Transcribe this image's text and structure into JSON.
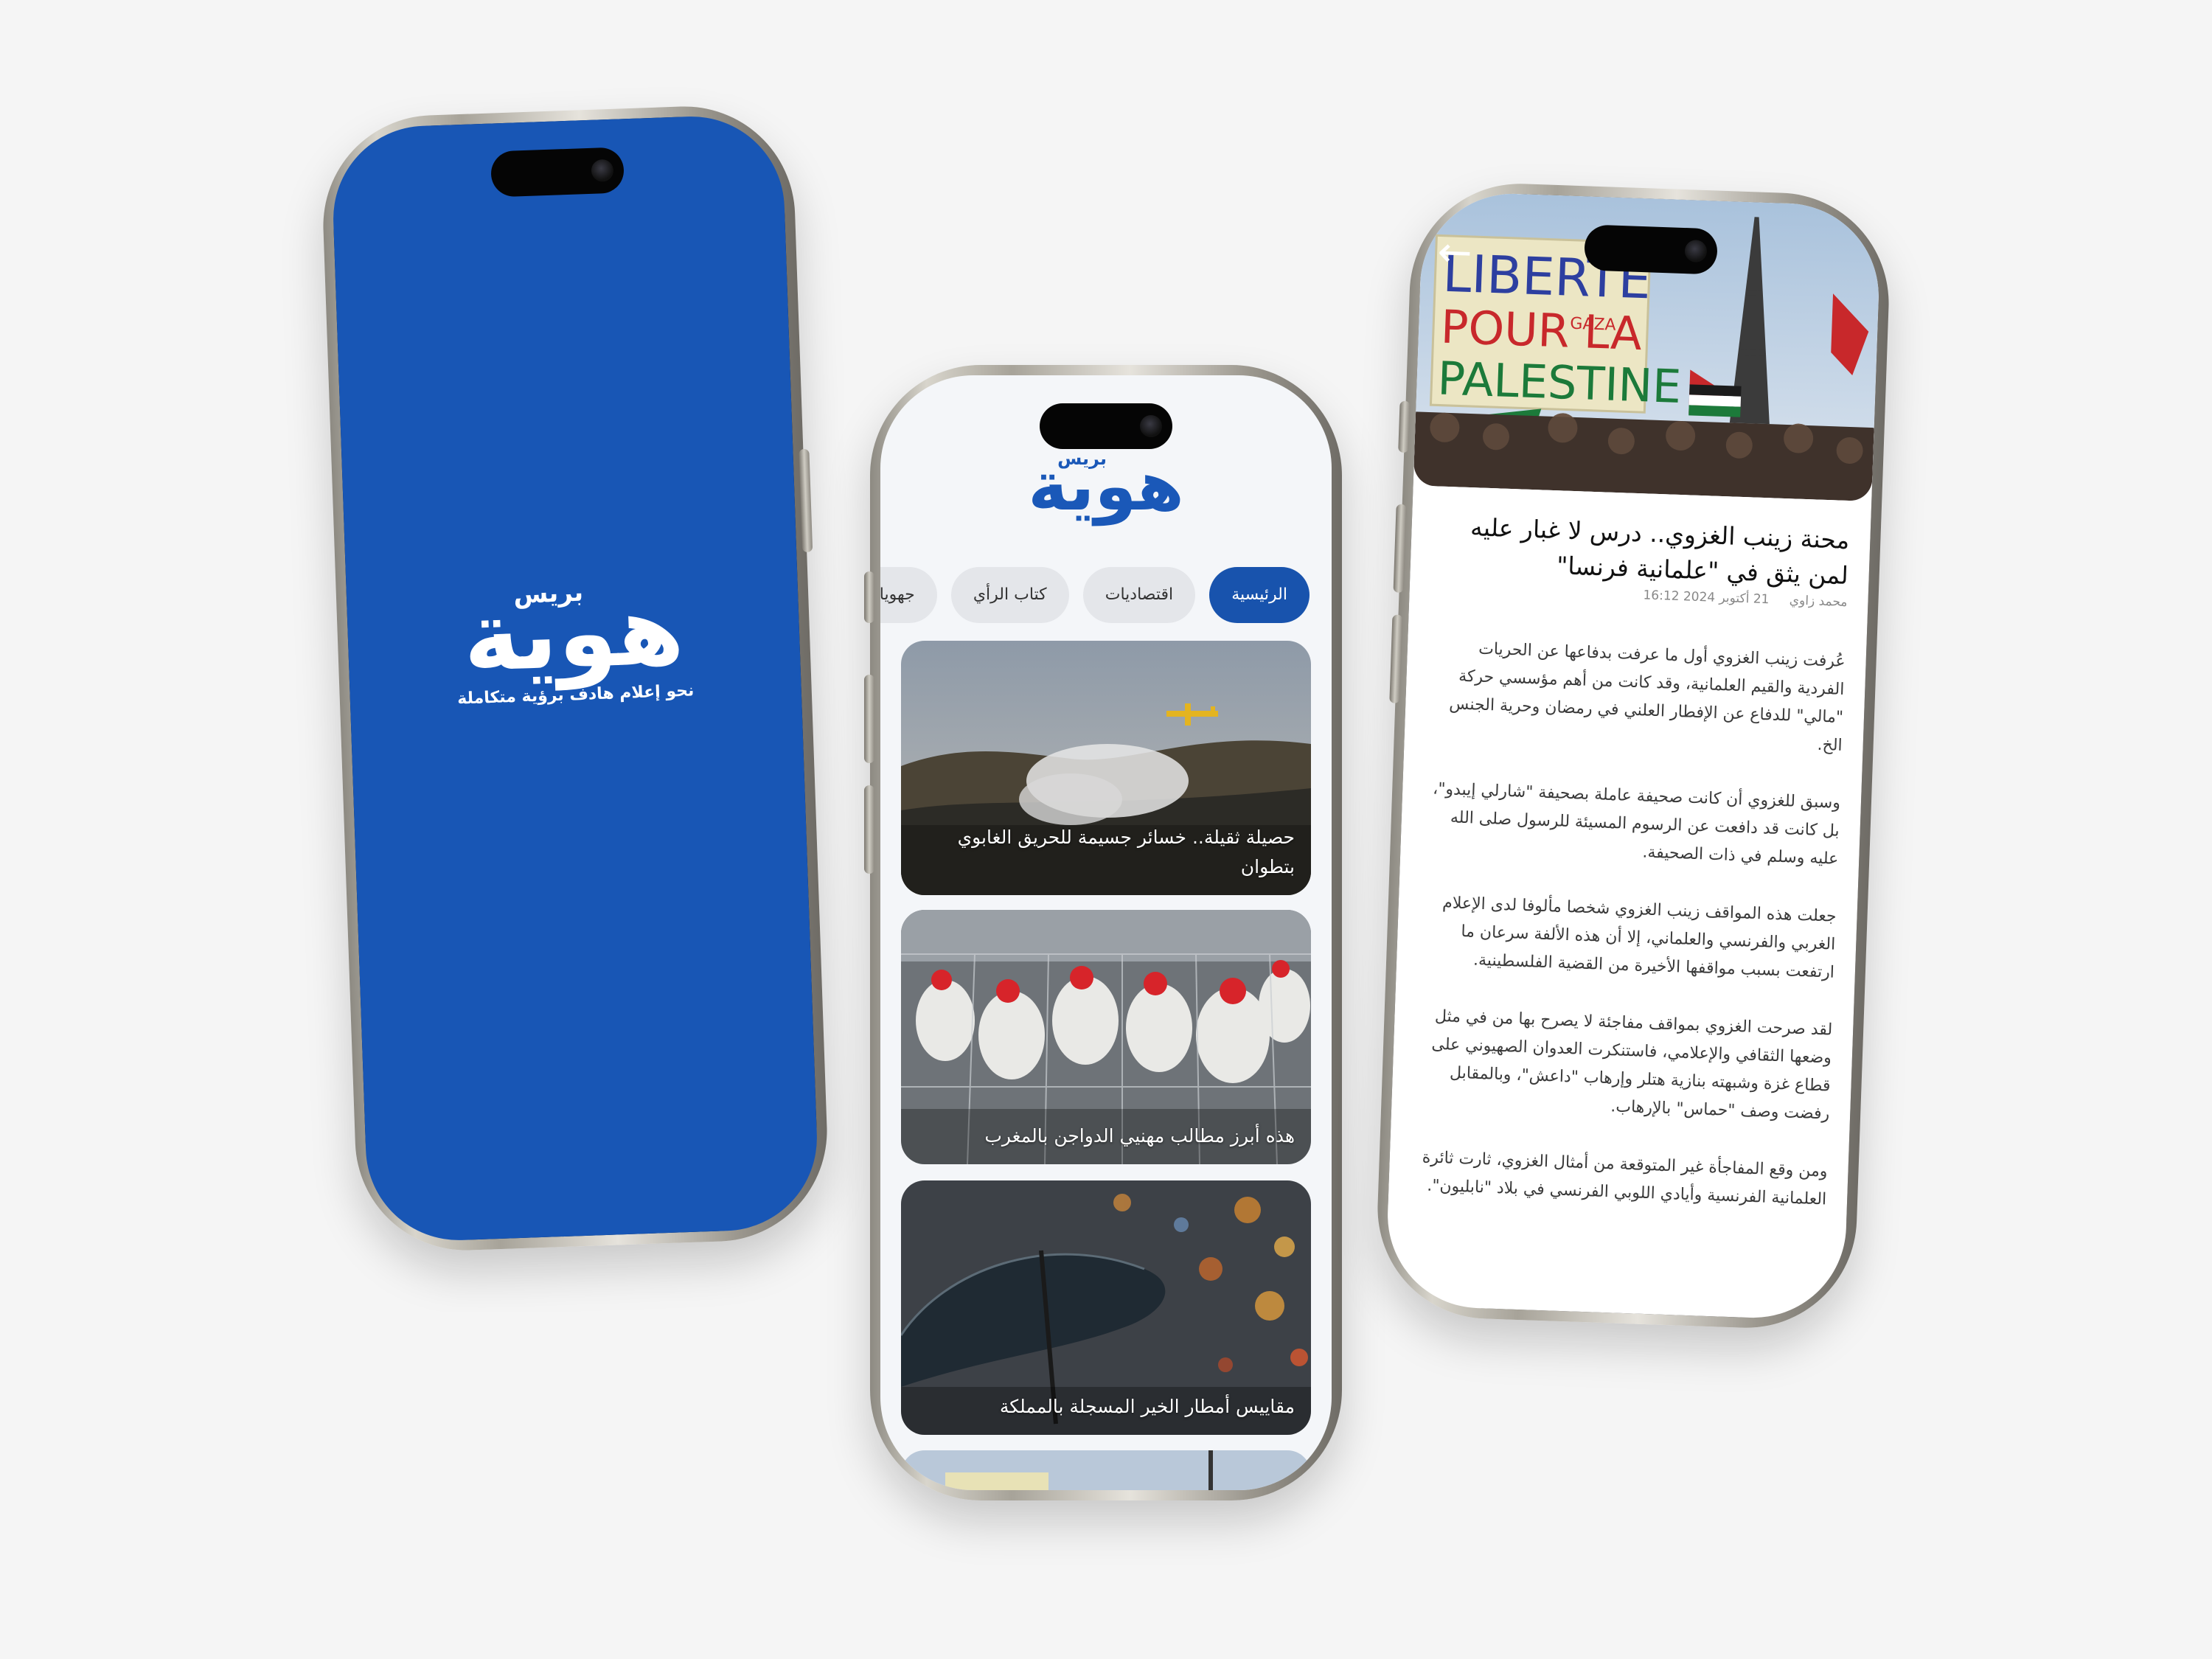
{
  "splash": {
    "logo_main": "هوية",
    "logo_sub": "بريس",
    "tagline": "نحو إعلام هادف برؤية متكاملة"
  },
  "feed": {
    "logo_main": "هوية",
    "logo_sub": "بريس",
    "tabs": [
      "الرئيسية",
      "اقتصاديات",
      "كتاب الرأي",
      "جهويات"
    ],
    "cards": [
      {
        "caption": "حصيلة ثقيلة.. خسائر جسيمة للحريق الغابوي بتطوان"
      },
      {
        "caption": "هذه أبرز مطالب مهنيي الدواجن بالمغرب"
      },
      {
        "caption": "مقاييس أمطار الخير المسجلة بالمملكة"
      }
    ]
  },
  "article": {
    "hero_sign": {
      "line1": "LIBERTE",
      "line2": "POUR LA",
      "line3": "PALESTINE",
      "tag": "GAZA"
    },
    "back_icon": "arrow-left-icon",
    "title": "محنة زينب الغزوي.. درس لا غبار عليه لمن يثق في \"علمانية فرنسا\"",
    "author": "محمد زاوي",
    "date": "21 أكتوبر 2024 16:12",
    "paragraphs": [
      "عُرفت زينب الغزوي أول ما عرفت بدفاعها عن الحريات الفردية والقيم العلمانية، وقد كانت من أهم مؤسسي حركة \"مالي\" للدفاع عن الإفطار العلني في رمضان وحرية الجنس الخ.",
      "وسبق للغزوي أن كانت صحيفة عاملة بصحيفة \"شارلي إيبدو\"، بل كانت قد دافعت عن الرسوم المسيئة للرسول صلى الله عليه وسلم في ذات الصحيفة.",
      "جعلت هذه المواقف زينب الغزوي شخصا مألوفا لدى الإعلام الغربي والفرنسي والعلماني، إلا أن هذه الألفة سرعان ما ارتفعت بسبب مواقفها الأخيرة من القضية الفلسطينية.",
      "لقد صرحت الغزوي بمواقف مفاجئة لا يصرح بها من في مثل وضعها الثقافي والإعلامي، فاستنكرت العدوان الصهيوني على قطاع غزة وشبهته بنازية هتلر وإرهاب \"داعش\"، وبالمقابل رفضت وصف \"حماس\" بالإرهاب.",
      "ومن وقع المفاجأة غير المتوقعة من أمثال الغزوي، ثارت ثائرة العلمانية الفرنسية وأيادي اللوبي الفرنسي في بلاد \"نابليون\"."
    ]
  },
  "colors": {
    "brand_blue": "#1856b5",
    "tab_active": "#1853ad",
    "background": "#f5f5f5"
  }
}
